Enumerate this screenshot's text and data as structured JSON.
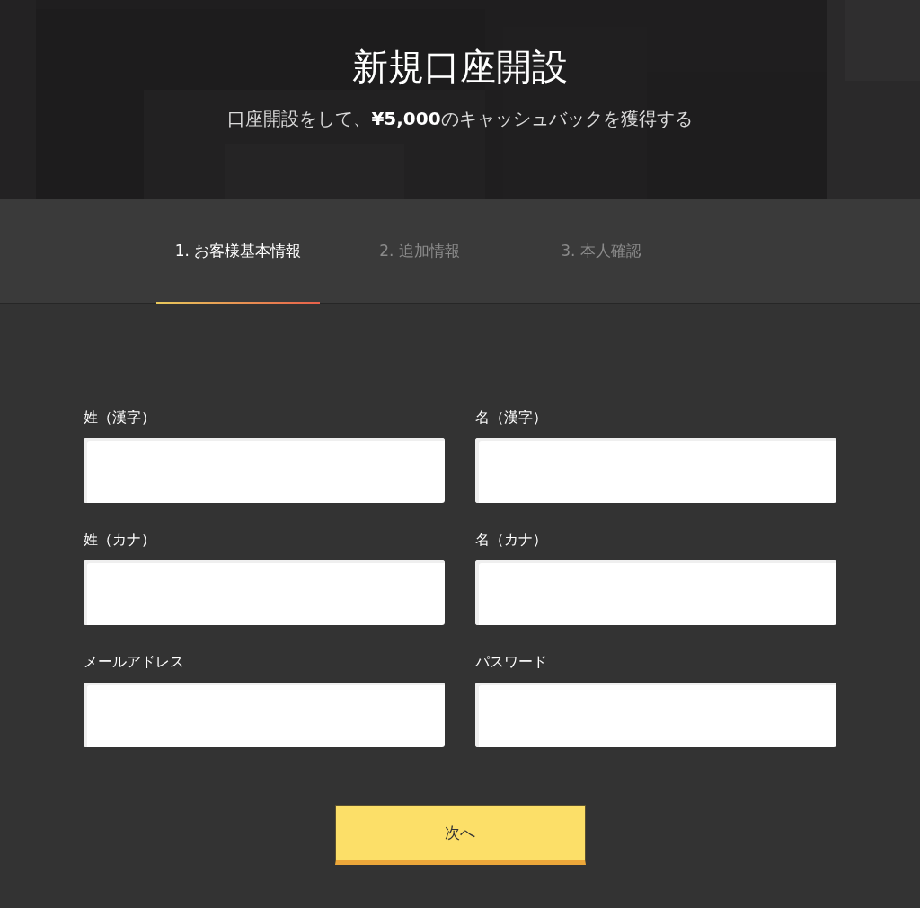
{
  "header": {
    "kind": "picture",
    "title": "新規口座開設",
    "subtitle": "口座開設をして、**¥5,000**のキャッシュバックを獲得する"
  },
  "steps": [
    {
      "label": "1. お客様基本情報",
      "selected": true
    },
    {
      "label": "2. 追加情報",
      "selected": false
    },
    {
      "label": "3. 本人確認",
      "selected": false
    }
  ],
  "fields": [
    {
      "label": "姓（漢字）"
    },
    {
      "label": "名（漢字）"
    },
    {
      "label": "姓（カナ）"
    },
    {
      "label": "名（カナ）"
    },
    {
      "label": "メールアドレス"
    },
    {
      "label": "パスワード"
    }
  ],
  "submit": "次へ"
}
